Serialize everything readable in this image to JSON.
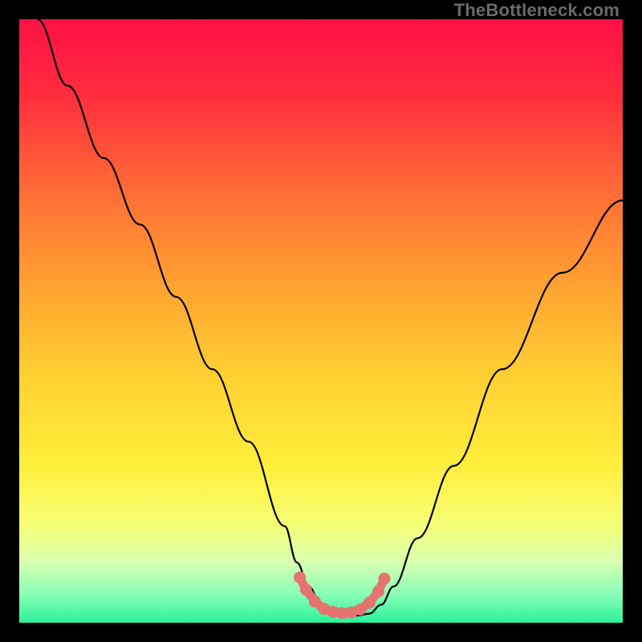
{
  "watermark": "TheBottleneck.com",
  "chart_data": {
    "type": "line",
    "title": "",
    "xlabel": "",
    "ylabel": "",
    "xlim": [
      0,
      100
    ],
    "ylim": [
      0,
      100
    ],
    "background_gradient": {
      "stops": [
        {
          "pct": 0,
          "color": "#ff1045"
        },
        {
          "pct": 12,
          "color": "#ff2b3e"
        },
        {
          "pct": 28,
          "color": "#ff6a36"
        },
        {
          "pct": 45,
          "color": "#ffa531"
        },
        {
          "pct": 60,
          "color": "#ffd232"
        },
        {
          "pct": 74,
          "color": "#ffee3c"
        },
        {
          "pct": 84,
          "color": "#f6ff78"
        },
        {
          "pct": 90,
          "color": "#d7ffb0"
        },
        {
          "pct": 95,
          "color": "#8dffb8"
        },
        {
          "pct": 100,
          "color": "#2cf19a"
        }
      ]
    },
    "series": [
      {
        "name": "bottleneck-curve",
        "color": "#000000",
        "x": [
          3,
          8,
          14,
          20,
          26,
          32,
          38,
          44,
          46,
          48,
          50,
          53,
          56,
          58,
          60,
          62,
          66,
          72,
          80,
          90,
          100
        ],
        "y": [
          100,
          89,
          77,
          66,
          54,
          42,
          30,
          16,
          10,
          6,
          3,
          1.5,
          1.2,
          1.5,
          3,
          6,
          14,
          26,
          42,
          58,
          70
        ]
      }
    ],
    "highlight": {
      "name": "valley-marker",
      "color": "#e57370",
      "points": [
        {
          "x": 46.5,
          "y": 7.5
        },
        {
          "x": 47.5,
          "y": 5.5
        },
        {
          "x": 49,
          "y": 3.5
        },
        {
          "x": 50.5,
          "y": 2.3
        },
        {
          "x": 52,
          "y": 1.8
        },
        {
          "x": 53.5,
          "y": 1.6
        },
        {
          "x": 55,
          "y": 1.7
        },
        {
          "x": 56.5,
          "y": 2.2
        },
        {
          "x": 58,
          "y": 3.3
        },
        {
          "x": 59.5,
          "y": 5.2
        },
        {
          "x": 60.5,
          "y": 7.3
        }
      ]
    }
  }
}
